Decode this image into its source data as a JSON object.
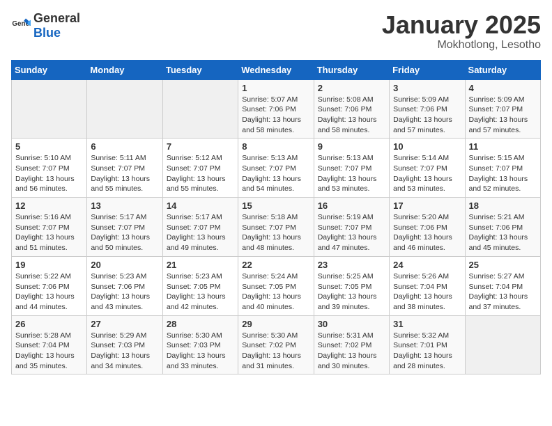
{
  "header": {
    "logo_general": "General",
    "logo_blue": "Blue",
    "title": "January 2025",
    "subtitle": "Mokhotlong, Lesotho"
  },
  "calendar": {
    "weekdays": [
      "Sunday",
      "Monday",
      "Tuesday",
      "Wednesday",
      "Thursday",
      "Friday",
      "Saturday"
    ],
    "weeks": [
      [
        {
          "day": null
        },
        {
          "day": null
        },
        {
          "day": null
        },
        {
          "day": "1",
          "sunrise": "5:07 AM",
          "sunset": "7:06 PM",
          "daylight": "13 hours and 58 minutes."
        },
        {
          "day": "2",
          "sunrise": "5:08 AM",
          "sunset": "7:06 PM",
          "daylight": "13 hours and 58 minutes."
        },
        {
          "day": "3",
          "sunrise": "5:09 AM",
          "sunset": "7:06 PM",
          "daylight": "13 hours and 57 minutes."
        },
        {
          "day": "4",
          "sunrise": "5:09 AM",
          "sunset": "7:07 PM",
          "daylight": "13 hours and 57 minutes."
        }
      ],
      [
        {
          "day": "5",
          "sunrise": "5:10 AM",
          "sunset": "7:07 PM",
          "daylight": "13 hours and 56 minutes."
        },
        {
          "day": "6",
          "sunrise": "5:11 AM",
          "sunset": "7:07 PM",
          "daylight": "13 hours and 55 minutes."
        },
        {
          "day": "7",
          "sunrise": "5:12 AM",
          "sunset": "7:07 PM",
          "daylight": "13 hours and 55 minutes."
        },
        {
          "day": "8",
          "sunrise": "5:13 AM",
          "sunset": "7:07 PM",
          "daylight": "13 hours and 54 minutes."
        },
        {
          "day": "9",
          "sunrise": "5:13 AM",
          "sunset": "7:07 PM",
          "daylight": "13 hours and 53 minutes."
        },
        {
          "day": "10",
          "sunrise": "5:14 AM",
          "sunset": "7:07 PM",
          "daylight": "13 hours and 53 minutes."
        },
        {
          "day": "11",
          "sunrise": "5:15 AM",
          "sunset": "7:07 PM",
          "daylight": "13 hours and 52 minutes."
        }
      ],
      [
        {
          "day": "12",
          "sunrise": "5:16 AM",
          "sunset": "7:07 PM",
          "daylight": "13 hours and 51 minutes."
        },
        {
          "day": "13",
          "sunrise": "5:17 AM",
          "sunset": "7:07 PM",
          "daylight": "13 hours and 50 minutes."
        },
        {
          "day": "14",
          "sunrise": "5:17 AM",
          "sunset": "7:07 PM",
          "daylight": "13 hours and 49 minutes."
        },
        {
          "day": "15",
          "sunrise": "5:18 AM",
          "sunset": "7:07 PM",
          "daylight": "13 hours and 48 minutes."
        },
        {
          "day": "16",
          "sunrise": "5:19 AM",
          "sunset": "7:07 PM",
          "daylight": "13 hours and 47 minutes."
        },
        {
          "day": "17",
          "sunrise": "5:20 AM",
          "sunset": "7:06 PM",
          "daylight": "13 hours and 46 minutes."
        },
        {
          "day": "18",
          "sunrise": "5:21 AM",
          "sunset": "7:06 PM",
          "daylight": "13 hours and 45 minutes."
        }
      ],
      [
        {
          "day": "19",
          "sunrise": "5:22 AM",
          "sunset": "7:06 PM",
          "daylight": "13 hours and 44 minutes."
        },
        {
          "day": "20",
          "sunrise": "5:23 AM",
          "sunset": "7:06 PM",
          "daylight": "13 hours and 43 minutes."
        },
        {
          "day": "21",
          "sunrise": "5:23 AM",
          "sunset": "7:05 PM",
          "daylight": "13 hours and 42 minutes."
        },
        {
          "day": "22",
          "sunrise": "5:24 AM",
          "sunset": "7:05 PM",
          "daylight": "13 hours and 40 minutes."
        },
        {
          "day": "23",
          "sunrise": "5:25 AM",
          "sunset": "7:05 PM",
          "daylight": "13 hours and 39 minutes."
        },
        {
          "day": "24",
          "sunrise": "5:26 AM",
          "sunset": "7:04 PM",
          "daylight": "13 hours and 38 minutes."
        },
        {
          "day": "25",
          "sunrise": "5:27 AM",
          "sunset": "7:04 PM",
          "daylight": "13 hours and 37 minutes."
        }
      ],
      [
        {
          "day": "26",
          "sunrise": "5:28 AM",
          "sunset": "7:04 PM",
          "daylight": "13 hours and 35 minutes."
        },
        {
          "day": "27",
          "sunrise": "5:29 AM",
          "sunset": "7:03 PM",
          "daylight": "13 hours and 34 minutes."
        },
        {
          "day": "28",
          "sunrise": "5:30 AM",
          "sunset": "7:03 PM",
          "daylight": "13 hours and 33 minutes."
        },
        {
          "day": "29",
          "sunrise": "5:30 AM",
          "sunset": "7:02 PM",
          "daylight": "13 hours and 31 minutes."
        },
        {
          "day": "30",
          "sunrise": "5:31 AM",
          "sunset": "7:02 PM",
          "daylight": "13 hours and 30 minutes."
        },
        {
          "day": "31",
          "sunrise": "5:32 AM",
          "sunset": "7:01 PM",
          "daylight": "13 hours and 28 minutes."
        },
        {
          "day": null
        }
      ]
    ]
  }
}
